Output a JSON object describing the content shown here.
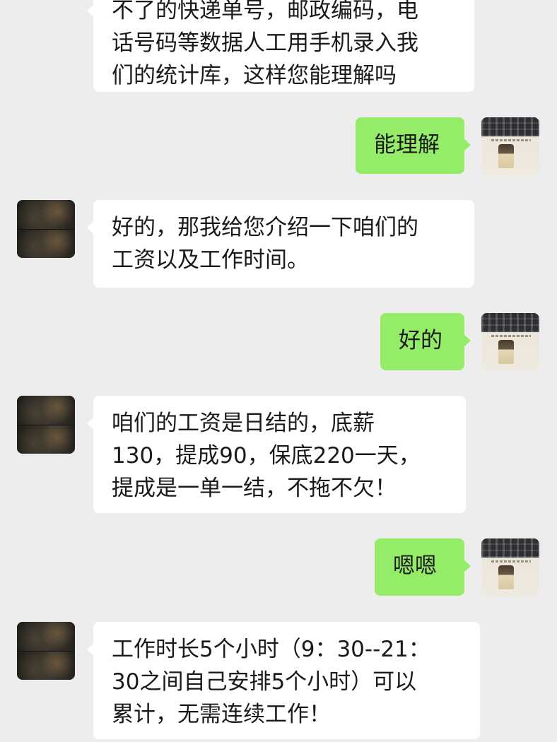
{
  "messages": [
    {
      "id": "m0",
      "side": "incoming",
      "lines": [
        "不了的快递单号，邮政编码，电",
        "话号码等数据人工用手机录入我",
        "们的统计库，这样您能理解吗"
      ]
    },
    {
      "id": "m1",
      "side": "outgoing",
      "lines": [
        "能理解"
      ]
    },
    {
      "id": "m2",
      "side": "incoming",
      "lines": [
        "好的，那我给您介绍一下咱们的",
        "工资以及工作时间。"
      ]
    },
    {
      "id": "m3",
      "side": "outgoing",
      "lines": [
        "好的"
      ]
    },
    {
      "id": "m4",
      "side": "incoming",
      "lines": [
        "咱们的工资是日结的，底薪",
        "130，提成90，保底220一天，",
        "提成是一单一结，不拖不欠！"
      ]
    },
    {
      "id": "m5",
      "side": "outgoing",
      "lines": [
        "嗯嗯"
      ]
    },
    {
      "id": "m6",
      "side": "incoming",
      "lines": [
        "工作时长5个小时（9：30--21：",
        "30之间自己安排5个小时）可以",
        "累计，无需连续工作！"
      ]
    }
  ],
  "colors": {
    "background": "#ededed",
    "incoming_bubble": "#ffffff",
    "outgoing_bubble": "#95ec69",
    "text": "#1a1a1a"
  },
  "icons": {
    "contact_avatar": "contact-avatar-photo",
    "user_avatar": "user-avatar-photo"
  }
}
